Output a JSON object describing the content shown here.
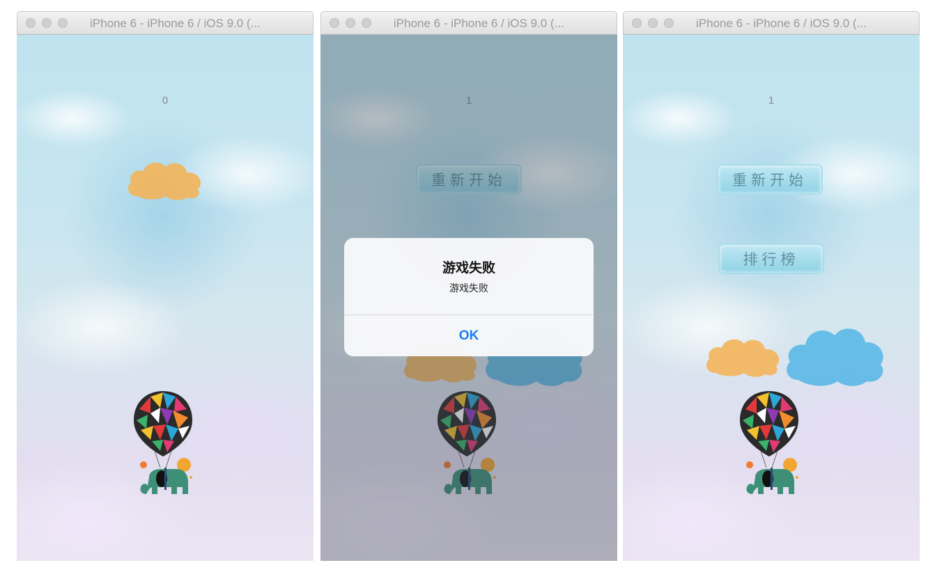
{
  "windows": [
    {
      "title": "iPhone 6 - iPhone 6 / iOS 9.0 (...",
      "score": "0"
    },
    {
      "title": "iPhone 6 - iPhone 6 / iOS 9.0 (...",
      "score": "1",
      "restart_label": "重新开始",
      "alert": {
        "title": "游戏失败",
        "message": "游戏失败",
        "ok_label": "OK"
      }
    },
    {
      "title": "iPhone 6 - iPhone 6 / iOS 9.0 (...",
      "score": "1",
      "restart_label": "重新开始",
      "leaderboard_label": "排行榜"
    }
  ],
  "colors": {
    "alert_button": "#1a7cf5",
    "orange_cloud": "#f3b45a",
    "blue_cloud": "#5ab8e6"
  },
  "icons": [
    "orange-cloud-icon",
    "blue-cloud-icon",
    "elephant-balloon-icon"
  ]
}
